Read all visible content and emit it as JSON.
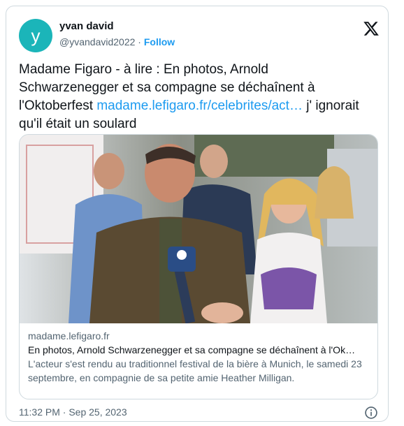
{
  "author": {
    "avatar_letter": "y",
    "display_name": "yvan david",
    "handle": "@yvandavid2022",
    "separator": " · ",
    "follow_label": "Follow"
  },
  "tweet": {
    "text_before": "Madame Figaro - à lire : En photos, Arnold\nSchwarzenegger et sa compagne se déchaînent à\nl'Oktoberfest ",
    "link": "madame.lefigaro.fr/celebrites/act…",
    "text_after": " j' ignorait\nqu'il était un soulard"
  },
  "link_card": {
    "domain": "madame.lefigaro.fr",
    "title": "En photos, Arnold Schwarzenegger et sa compagne se déchaînent à l'Ok…",
    "description": "L'acteur s'est rendu au traditionnel festival de la bière à Munich, le samedi 23 septembre, en compagnie de sa petite amie Heather Milligan."
  },
  "footer": {
    "timestamp": "11:32 PM · Sep 25, 2023"
  },
  "icons": {
    "brand": "x-logo-icon",
    "info": "info-icon"
  },
  "colors": {
    "accent": "#1d9bf0",
    "avatar_bg": "#1bb5b9",
    "muted_text": "#536471",
    "border": "#cfd9de"
  }
}
